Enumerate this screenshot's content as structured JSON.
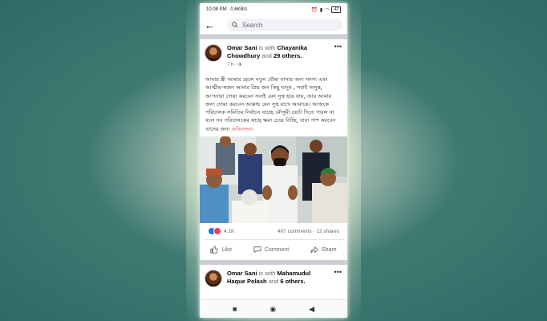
{
  "status": {
    "time": "10:08 PM",
    "speed": "0.6KB/s",
    "battery": "42"
  },
  "search": {
    "placeholder": "Search"
  },
  "post1": {
    "author": "Omar Sani",
    "with_text": "is with",
    "tagged": "Chayanika Chowdhury",
    "and_text": "and",
    "others": "29 others.",
    "time": "7 h ·",
    "body": "আমার স্ত্রী আমার ছেলে নতুন বৌমা বাসার অন্য সদস্য এবং আত্মীয়-স্বজন আমার প্রিয় জন কিছু মানুষ , সবাই অসুস্থ, আপনারা দোয়া করবেন সবাই যেন সুস্থ হয়ে যায়, আর আমার জন্য দোয়া করবেন আল্লাহ যেন সুস্থ রাখে আমাকে। আজকে পরিচালক সমিতির নির্বাচন যাচ্ছে মৌসুমী ভোট দিতে পারল না বলে সব পরিচালকের কাছে ক্ষমা চেয়ে নিচ্ছি, যারা পাশ করবেন তাদের জন্য",
    "body_link": "অভিনন্দন।",
    "reactions": "4.1K",
    "comments_shares": "407 comments · 12 shares"
  },
  "actions": {
    "like": "Like",
    "comment": "Comment",
    "share": "Share"
  },
  "post2": {
    "author": "Omar Sani",
    "with_text": "is with",
    "tagged": "Mahamudul Haque Polash",
    "and_text": "and",
    "others": "6 others."
  },
  "colors": {
    "accent": "#1877f2",
    "link": "#e0463b",
    "background": "#2f6b66"
  }
}
